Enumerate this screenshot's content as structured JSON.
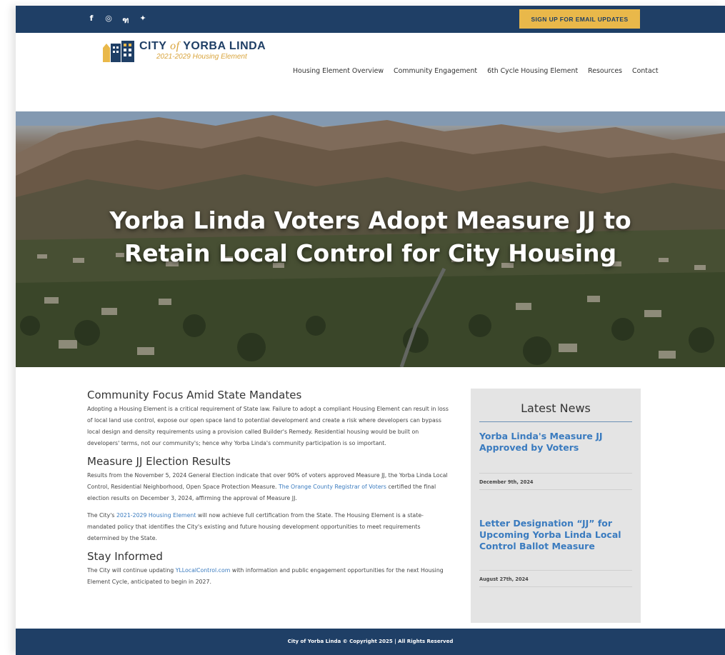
{
  "topbar": {
    "social_icons": [
      "facebook-icon",
      "instagram-icon",
      "nextdoor-icon",
      "twitter-icon"
    ],
    "social_glyphs": [
      "f",
      "◎",
      "ฑ",
      "✦"
    ],
    "signup_label": "SIGN UP FOR EMAIL UPDATES"
  },
  "logo": {
    "line1_city": "CITY",
    "line1_of": "of",
    "line1_name": "YORBA LINDA",
    "line2": "2021-2029 Housing Element"
  },
  "nav": [
    "Housing Element Overview",
    "Community Engagement",
    "6th Cycle Housing Element",
    "Resources",
    "Contact"
  ],
  "hero": {
    "title_line1": "Yorba Linda Voters Adopt Measure JJ to",
    "title_line2": "Retain Local Control for City Housing"
  },
  "main": {
    "s1_heading": "Community Focus Amid State Mandates",
    "s1_body": "Adopting a Housing Element is a critical requirement of State law. Failure to adopt a compliant Housing Element can result in loss of local land use control, expose our open space land to potential development and create a risk where developers can bypass local design and density requirements using a provision called Builder's Remedy. Residential housing would be built on developers' terms, not our community's; hence why Yorba Linda's community participation is so important.",
    "s2_heading": "Measure JJ Election Results",
    "s2_body_a": "Results from the November 5, 2024 General Election indicate that over 90% of voters approved Measure JJ, the Yorba Linda Local Control, Residential Neighborhood, Open Space Protection Measure.",
    "s2_link": "The Orange County Registrar of Voters",
    "s2_body_b": "certified the final election results on December 3, 2024, affirming the approval of Measure JJ.",
    "s2_p2_a": "The City's",
    "s2_p2_link": "2021-2029 Housing Element",
    "s2_p2_b": "will now achieve full certification from the State. The Housing Element is a state-mandated policy that identifies the City's existing and future housing development opportunities to meet requirements determined by the State.",
    "s3_heading": "Stay Informed",
    "s3_body_a": "The City will continue updating",
    "s3_link": "YLLocalControl.com",
    "s3_body_b": "with information and public engagement opportunities for the next Housing Element Cycle, anticipated to begin in 2027."
  },
  "sidebar": {
    "title": "Latest News",
    "items": [
      {
        "title": "Yorba Linda's Measure JJ Approved by Voters",
        "date": "December 9th, 2024"
      },
      {
        "title": "Letter Designation “JJ” for Upcoming Yorba Linda Local Control Ballot Measure",
        "date": "August 27th, 2024"
      }
    ]
  },
  "footer": {
    "text": "City of Yorba Linda © Copyright 2025 | All Rights Reserved"
  },
  "colors": {
    "navy": "#1f3f66",
    "gold": "#e9b84a",
    "link_blue": "#3a7bbf",
    "sidebar_bg": "#e4e4e4"
  }
}
